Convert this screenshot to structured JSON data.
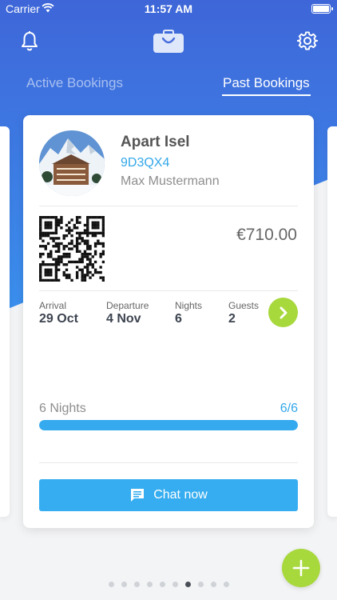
{
  "status_bar": {
    "carrier": "Carrier",
    "time": "11:57 AM"
  },
  "nav": {
    "left_icon": "bell-icon",
    "center_icon": "briefcase-icon",
    "right_icon": "gear-icon"
  },
  "tabs": [
    {
      "label": "Active Bookings",
      "active": false
    },
    {
      "label": "Past Bookings",
      "active": true
    }
  ],
  "booking": {
    "hotel_name": "Apart Isel",
    "code": "9D3QX4",
    "guest_name": "Max Mustermann",
    "price": "€710.00",
    "stats": [
      {
        "label": "Arrival",
        "value": "29 Oct"
      },
      {
        "label": "Departure",
        "value": "4 Nov"
      },
      {
        "label": "Nights",
        "value": "6"
      },
      {
        "label": "Guests",
        "value": "2"
      }
    ],
    "progress_label": "6 Nights",
    "progress_count": "6/6",
    "progress_fraction": 1.0,
    "chat_label": "Chat now"
  },
  "pager": {
    "total": 10,
    "active_index": 6
  },
  "colors": {
    "header_blue": "#3e66d8",
    "accent_blue": "#33a7ea",
    "accent_green": "#a7d83c"
  }
}
